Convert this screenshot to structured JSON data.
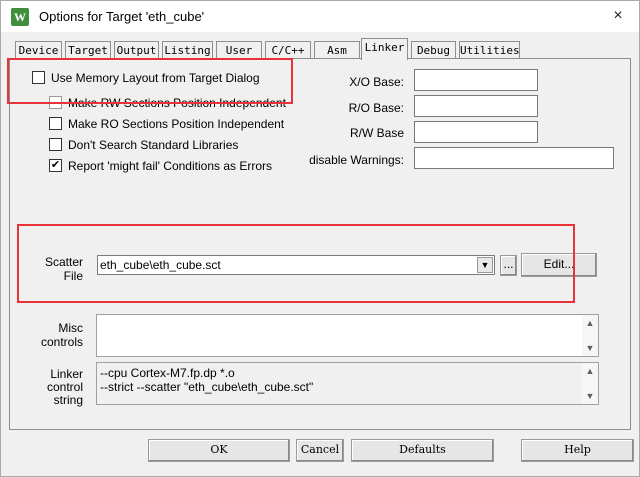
{
  "window": {
    "title": "Options for Target 'eth_cube'",
    "close": "×"
  },
  "tabs": [
    "Device",
    "Target",
    "Output",
    "Listing",
    "User",
    "C/C++",
    "Asm",
    "Linker",
    "Debug",
    "Utilities"
  ],
  "active_tab": "Linker",
  "options": {
    "use_memory_layout": {
      "label": "Use Memory Layout from Target Dialog",
      "checked": false
    },
    "rw_independent": {
      "label": "Make RW Sections Position Independent",
      "checked": false
    },
    "ro_independent": {
      "label": "Make RO Sections Position Independent",
      "checked": false
    },
    "no_std_libs": {
      "label": "Don't Search Standard Libraries",
      "checked": false
    },
    "might_fail_errors": {
      "label": "Report 'might fail' Conditions as Errors",
      "checked": true
    }
  },
  "fields": {
    "xo_base": {
      "label": "X/O Base:",
      "value": ""
    },
    "ro_base": {
      "label": "R/O Base:",
      "value": ""
    },
    "rw_base": {
      "label": "R/W Base",
      "value": ""
    },
    "disable_warnings": {
      "label": "disable Warnings:",
      "value": ""
    }
  },
  "scatter": {
    "label_line1": "Scatter",
    "label_line2": "File",
    "value": "eth_cube\\eth_cube.sct",
    "browse": "...",
    "edit": "Edit..."
  },
  "misc": {
    "label_line1": "Misc",
    "label_line2": "controls",
    "value": ""
  },
  "linker_string": {
    "label_line1": "Linker",
    "label_line2": "control",
    "label_line3": "string",
    "line1": "--cpu Cortex-M7.fp.dp *.o",
    "line2": "--strict --scatter \"eth_cube\\eth_cube.sct\""
  },
  "buttons": {
    "ok": "OK",
    "cancel": "Cancel",
    "defaults": "Defaults",
    "help": "Help"
  },
  "colors": {
    "highlight_box": "#e8333a",
    "app_icon": "#3f8f3f"
  }
}
